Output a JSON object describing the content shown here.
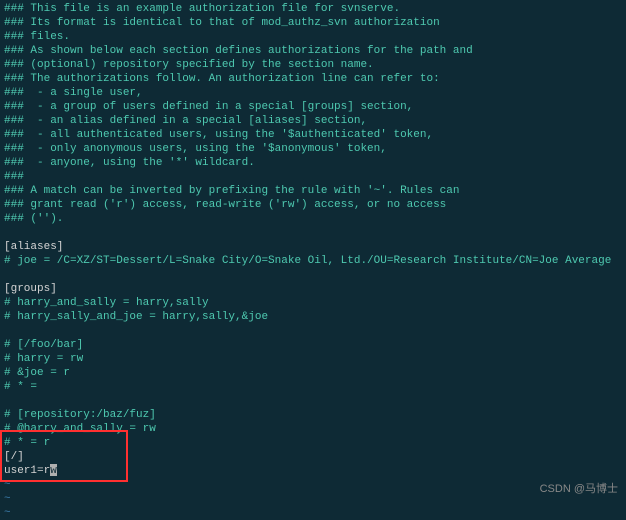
{
  "lines": [
    {
      "text": "### This file is an example authorization file for svnserve.",
      "cls": "cyan"
    },
    {
      "text": "### Its format is identical to that of mod_authz_svn authorization",
      "cls": "cyan"
    },
    {
      "text": "### files.",
      "cls": "cyan"
    },
    {
      "text": "### As shown below each section defines authorizations for the path and",
      "cls": "cyan"
    },
    {
      "text": "### (optional) repository specified by the section name.",
      "cls": "cyan"
    },
    {
      "text": "### The authorizations follow. An authorization line can refer to:",
      "cls": "cyan"
    },
    {
      "text": "###  - a single user,",
      "cls": "cyan"
    },
    {
      "text": "###  - a group of users defined in a special [groups] section,",
      "cls": "cyan"
    },
    {
      "text": "###  - an alias defined in a special [aliases] section,",
      "cls": "cyan"
    },
    {
      "text": "###  - all authenticated users, using the '$authenticated' token,",
      "cls": "cyan"
    },
    {
      "text": "###  - only anonymous users, using the '$anonymous' token,",
      "cls": "cyan"
    },
    {
      "text": "###  - anyone, using the '*' wildcard.",
      "cls": "cyan"
    },
    {
      "text": "###",
      "cls": "cyan"
    },
    {
      "text": "### A match can be inverted by prefixing the rule with '~'. Rules can",
      "cls": "cyan"
    },
    {
      "text": "### grant read ('r') access, read-write ('rw') access, or no access",
      "cls": "cyan"
    },
    {
      "text": "### ('').",
      "cls": "cyan"
    },
    {
      "text": "",
      "cls": "cyan"
    },
    {
      "text": "[aliases]",
      "cls": "white"
    },
    {
      "text": "# joe = /C=XZ/ST=Dessert/L=Snake City/O=Snake Oil, Ltd./OU=Research Institute/CN=Joe Average",
      "cls": "cyan"
    },
    {
      "text": "",
      "cls": "cyan"
    },
    {
      "text": "[groups]",
      "cls": "white"
    },
    {
      "text": "# harry_and_sally = harry,sally",
      "cls": "cyan"
    },
    {
      "text": "# harry_sally_and_joe = harry,sally,&joe",
      "cls": "cyan"
    },
    {
      "text": "",
      "cls": "cyan"
    },
    {
      "text": "# [/foo/bar]",
      "cls": "cyan"
    },
    {
      "text": "# harry = rw",
      "cls": "cyan"
    },
    {
      "text": "# &joe = r",
      "cls": "cyan"
    },
    {
      "text": "# * =",
      "cls": "cyan"
    },
    {
      "text": "",
      "cls": "cyan"
    },
    {
      "text": "# [repository:/baz/fuz]",
      "cls": "cyan"
    },
    {
      "text": "# @harry_and_sally = rw",
      "cls": "cyan"
    },
    {
      "text": "# * = r",
      "cls": "cyan"
    },
    {
      "text": "[/]",
      "cls": "white"
    },
    {
      "text": "user1=r",
      "cls": "white",
      "cursor": true,
      "suffix": "w"
    },
    {
      "text": "~",
      "cls": "blue"
    },
    {
      "text": "~",
      "cls": "blue"
    },
    {
      "text": "~",
      "cls": "blue"
    }
  ],
  "watermark": "CSDN @马博士"
}
